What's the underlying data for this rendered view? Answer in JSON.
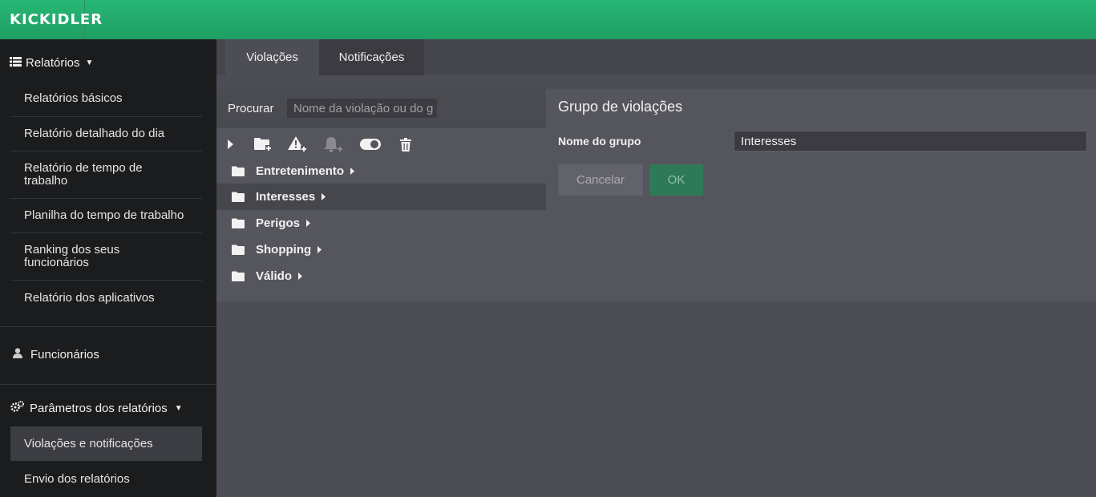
{
  "app": {
    "logo_text": "KICKIDLER"
  },
  "sidebar": {
    "reports_header": "Relatórios",
    "report_items": [
      {
        "label": "Relatórios básicos"
      },
      {
        "label": "Relatório detalhado do dia"
      },
      {
        "label": "Relatório de tempo de trabalho"
      },
      {
        "label": "Planilha do tempo de trabalho"
      },
      {
        "label": "Ranking dos seus funcionários"
      },
      {
        "label": "Relatório dos aplicativos"
      }
    ],
    "employees_label": "Funcionários",
    "params_header": "Parâmetros dos relatórios",
    "params_items": [
      {
        "label": "Violações e notificações",
        "active": true
      },
      {
        "label": "Envio dos relatórios",
        "active": false
      }
    ]
  },
  "tabs": [
    {
      "label": "Violações",
      "active": true
    },
    {
      "label": "Notificações",
      "active": false
    }
  ],
  "search": {
    "label": "Procurar",
    "placeholder": "Nome da violação ou do g"
  },
  "toolbar_icons": [
    "expand-icon",
    "add-folder-icon",
    "add-violation-icon",
    "add-notification-icon",
    "toggle-icon",
    "trash-icon"
  ],
  "tree": [
    {
      "label": "Entretenimento",
      "selected": false
    },
    {
      "label": "Interesses",
      "selected": true
    },
    {
      "label": "Perigos",
      "selected": false
    },
    {
      "label": "Shopping",
      "selected": false
    },
    {
      "label": "Válido",
      "selected": false
    }
  ],
  "group_form": {
    "title": "Grupo de violações",
    "name_label": "Nome do grupo",
    "name_value": "Interesses",
    "cancel_label": "Cancelar",
    "ok_label": "OK"
  },
  "colors": {
    "topbar": "#23ad6c",
    "sidebar": "#1b1c1e",
    "main": "#4d4d55",
    "ok_button": "#2e7a58"
  }
}
